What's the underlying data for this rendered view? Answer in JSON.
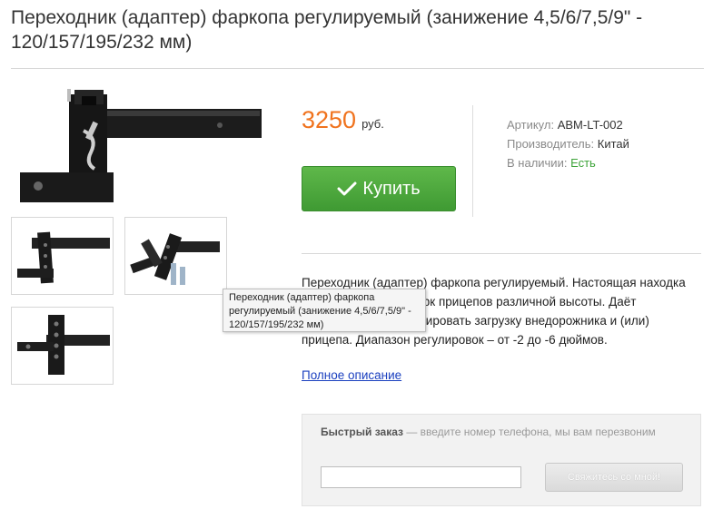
{
  "product": {
    "title": "Переходник (адаптер) фаркопа регулируемый (занижение 4,5/6/7,5/9\" - 120/157/195/232 мм)"
  },
  "gallery": {
    "main_alt": "main-product-image",
    "thumbnails": [
      "thumb-1",
      "thumb-2",
      "thumb-3"
    ]
  },
  "price": {
    "value": "3250",
    "currency": "руб."
  },
  "buy_button": {
    "label": "Купить",
    "color": "#4caf3e"
  },
  "meta": {
    "article_label": "Артикул:",
    "article_value": "ABM-LT-002",
    "manufacturer_label": "Производитель:",
    "manufacturer_value": "Китай",
    "stock_label": "В наличии:",
    "stock_value": "Есть"
  },
  "description": {
    "text": "Переходник (адаптер) фаркопа регулируемый. Настоящая находка для тех, кто имеет парк прицепов различной высоты. Даёт возможность компенсировать загрузку внедорожника и (или) прицепа. Диапазон регулировок – от -2 до -6 дюймов.",
    "more_link": "Полное описание"
  },
  "tooltip": {
    "text": "Переходник (адаптер) фаркопа регулируемый (занижение 4,5/6/7,5/9\" - 120/157/195/232 мм)"
  },
  "quick_order": {
    "title": "Быстрый заказ",
    "hint": " — введите номер телефона, мы вам перезвоним",
    "phone_value": "",
    "button_label": "Свяжитесь со мной!"
  },
  "colors": {
    "price": "#f0731e",
    "in_stock": "#3ea43a",
    "link": "#1a3fbf"
  }
}
